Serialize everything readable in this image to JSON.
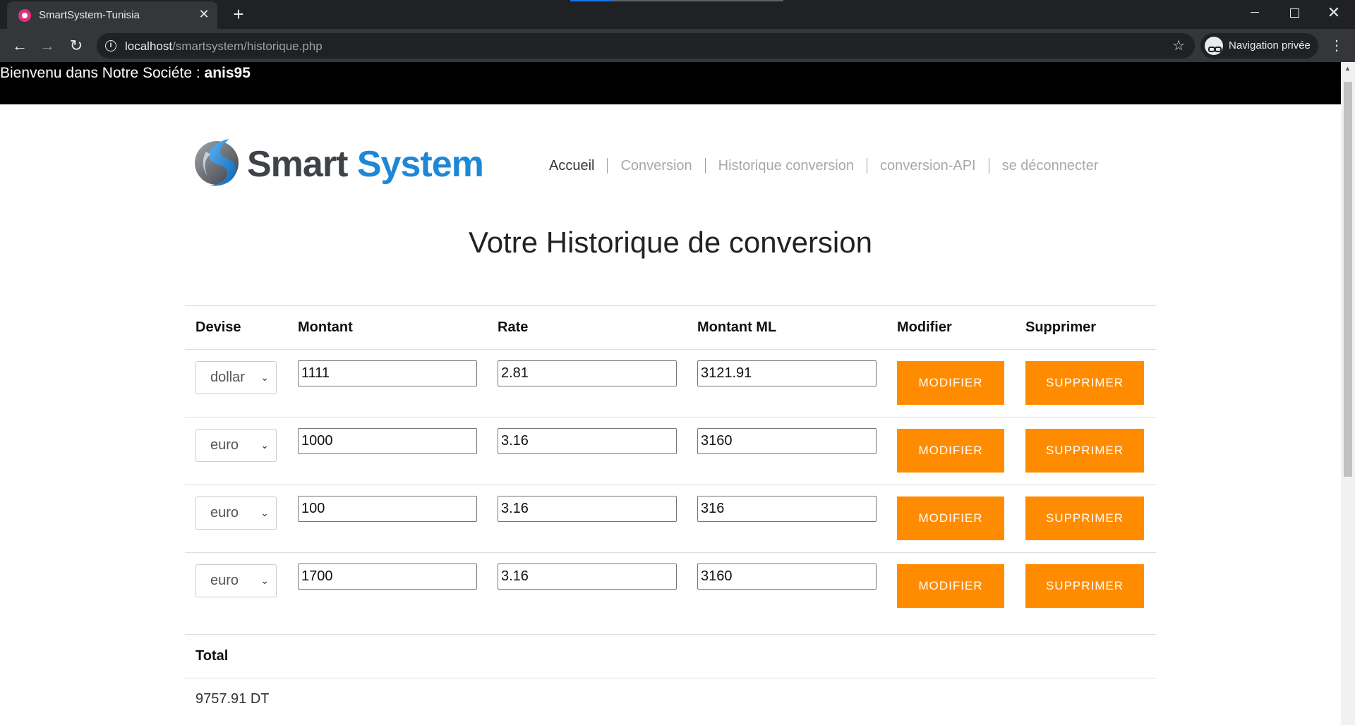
{
  "browser": {
    "tab_title": "SmartSystem-Tunisia",
    "tab_close": "✕",
    "new_tab": "+",
    "url_host": "localhost",
    "url_path": "/smartsystem/historique.php",
    "incognito_label": "Navigation privée"
  },
  "welcome": {
    "prefix": "Bienvenu dans Notre Sociéte : ",
    "username": "anis95"
  },
  "logo": {
    "word1": "Smart",
    "word2": "System",
    "colors": {
      "dark": "#3d4349",
      "blue": "#1e88d6"
    }
  },
  "nav": {
    "items": [
      "Accueil",
      "Conversion",
      "Historique conversion",
      "conversion-API",
      "se déconnecter"
    ]
  },
  "page": {
    "title": "Votre Historique de conversion"
  },
  "table": {
    "headers": [
      "Devise",
      "Montant",
      "Rate",
      "Montant ML",
      "Modifier",
      "Supprimer"
    ],
    "rows": [
      {
        "devise": "dollar",
        "montant": "1111",
        "rate": "2.81",
        "montant_ml": "3121.91",
        "modifier": "MODIFIER",
        "supprimer": "SUPPRIMER"
      },
      {
        "devise": "euro",
        "montant": "1000",
        "rate": "3.16",
        "montant_ml": "3160",
        "modifier": "MODIFIER",
        "supprimer": "SUPPRIMER"
      },
      {
        "devise": "euro",
        "montant": "100",
        "rate": "3.16",
        "montant_ml": "316",
        "modifier": "MODIFIER",
        "supprimer": "SUPPRIMER"
      },
      {
        "devise": "euro",
        "montant": "1700",
        "rate": "3.16",
        "montant_ml": "3160",
        "modifier": "MODIFIER",
        "supprimer": "SUPPRIMER"
      }
    ],
    "total_label": "Total",
    "total_value": "9757.91 DT"
  },
  "colors": {
    "accent_orange": "#ff8c00",
    "welcome_bar": "#000000"
  }
}
